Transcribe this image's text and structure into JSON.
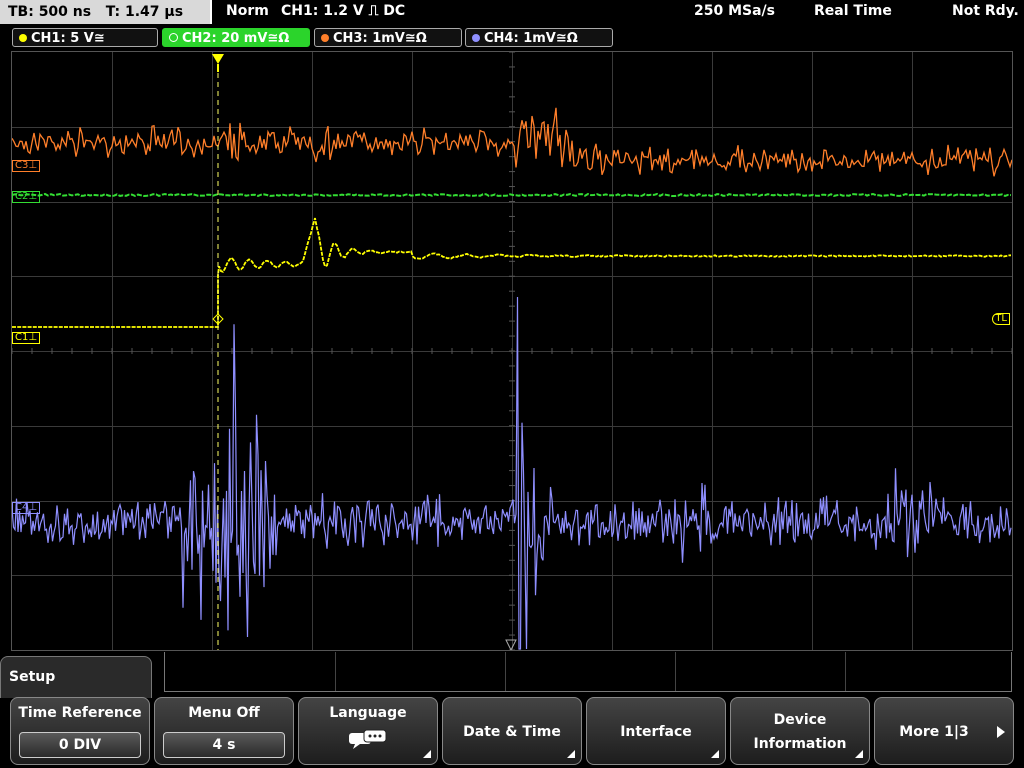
{
  "status": {
    "timebase": "TB: 500 ns",
    "trigger_time": "T: 1.47 µs",
    "mode": "Norm",
    "trigger": "CH1: 1.2 V ⎍ DC",
    "sample_rate": "250 MSa/s",
    "acq_mode": "Real Time",
    "state": "Not Rdy."
  },
  "channels": [
    {
      "label": "CH1: 5 V≅",
      "color": "#ffff00"
    },
    {
      "label": "CH2: 20 mV≅Ω",
      "color": "#33ff33"
    },
    {
      "label": "CH3: 1mV≅Ω",
      "color": "#ff7f2a"
    },
    {
      "label": "CH4: 1mV≅Ω",
      "color": "#8f8fff"
    }
  ],
  "trace_labels": {
    "c3": "C3⊥",
    "c2": "C2⊥",
    "c1": "C1⊥",
    "c4": "C4⊥",
    "tl": "TL"
  },
  "menu": {
    "title": "Setup",
    "time_reference": {
      "label": "Time Reference",
      "value": "0 DIV"
    },
    "menu_off": {
      "label": "Menu Off",
      "value": "4 s"
    },
    "language": {
      "label": "Language"
    },
    "date_time": {
      "label": "Date & Time"
    },
    "interface": {
      "label": "Interface"
    },
    "device_information": {
      "line1": "Device",
      "line2": "Information"
    },
    "more": {
      "label": "More 1|3"
    }
  }
}
